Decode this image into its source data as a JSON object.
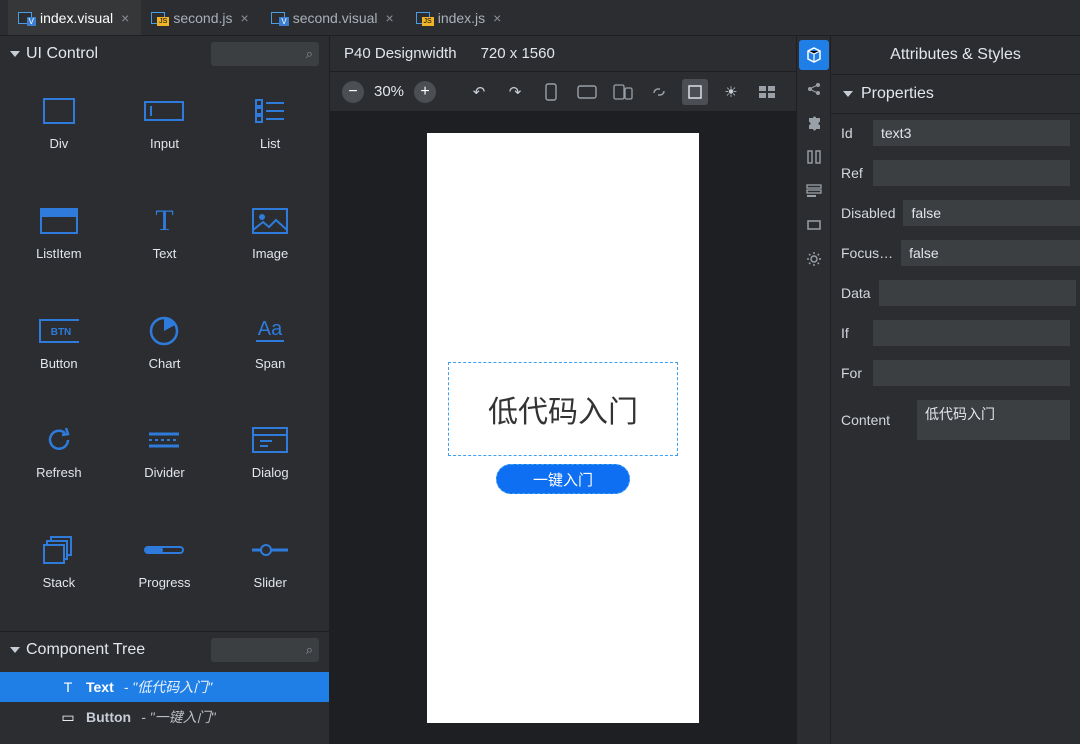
{
  "tabs": [
    {
      "label": "index.visual",
      "icon": "vis",
      "active": true
    },
    {
      "label": "second.js",
      "icon": "js",
      "active": false
    },
    {
      "label": "second.visual",
      "icon": "vis",
      "active": false
    },
    {
      "label": "index.js",
      "icon": "js",
      "active": false
    }
  ],
  "left": {
    "controls_title": "UI Control",
    "controls": [
      {
        "label": "Div",
        "icon": "div"
      },
      {
        "label": "Input",
        "icon": "input"
      },
      {
        "label": "List",
        "icon": "list"
      },
      {
        "label": "ListItem",
        "icon": "listitem"
      },
      {
        "label": "Text",
        "icon": "text"
      },
      {
        "label": "Image",
        "icon": "image"
      },
      {
        "label": "Button",
        "icon": "button"
      },
      {
        "label": "Chart",
        "icon": "chart"
      },
      {
        "label": "Span",
        "icon": "span"
      },
      {
        "label": "Refresh",
        "icon": "refresh"
      },
      {
        "label": "Divider",
        "icon": "divider"
      },
      {
        "label": "Dialog",
        "icon": "dialog"
      },
      {
        "label": "Stack",
        "icon": "stack"
      },
      {
        "label": "Progress",
        "icon": "progress"
      },
      {
        "label": "Slider",
        "icon": "slider"
      }
    ],
    "tree_title": "Component Tree",
    "tree": [
      {
        "name": "Text",
        "value": "- \"低代码入门\"",
        "icon": "T",
        "selected": true
      },
      {
        "name": "Button",
        "value": "- \"一键入门\"",
        "icon": "▭",
        "selected": false
      }
    ]
  },
  "center": {
    "device": "P40 Designwidth",
    "size": "720 x 1560",
    "zoom": "30%",
    "preview_text": "低代码入门",
    "preview_button": "一键入门"
  },
  "right": {
    "title": "Attributes & Styles",
    "section": "Properties",
    "rows": [
      {
        "label": "Id",
        "value": "text3",
        "type": "input"
      },
      {
        "label": "Ref",
        "value": "",
        "type": "input"
      },
      {
        "label": "Disabled",
        "value": "false",
        "type": "input"
      },
      {
        "label": "Focus…",
        "value": "false",
        "type": "input"
      },
      {
        "label": "Data",
        "value": "",
        "type": "input"
      },
      {
        "label": "If",
        "value": "",
        "type": "input"
      },
      {
        "label": "For",
        "value": "",
        "type": "input"
      },
      {
        "label": "Content",
        "value": "低代码入门",
        "type": "textarea"
      }
    ],
    "tabs": [
      "properties",
      "pieces",
      "columns",
      "form",
      "rect",
      "settings"
    ]
  }
}
